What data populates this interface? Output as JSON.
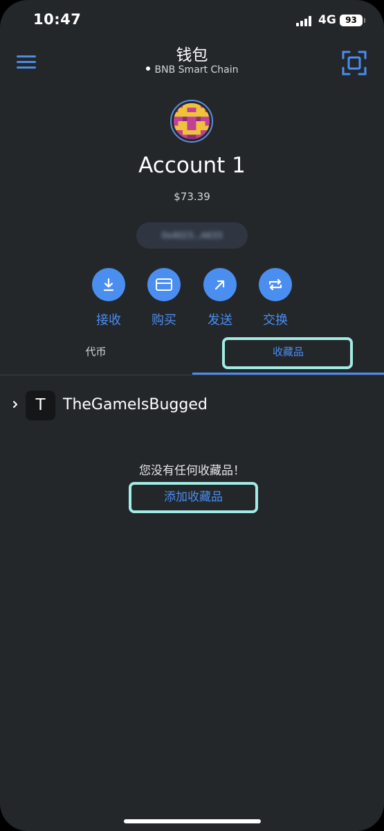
{
  "status_bar": {
    "time": "10:47",
    "network": "4G",
    "battery": "93"
  },
  "header": {
    "title": "钱包",
    "network_name": "BNB Smart Chain"
  },
  "account": {
    "name": "Account 1",
    "balance": "$73.39",
    "address": "0x4023...A633"
  },
  "actions": [
    {
      "label": "接收",
      "icon": "download-icon"
    },
    {
      "label": "购买",
      "icon": "card-icon"
    },
    {
      "label": "发送",
      "icon": "arrow-up-right-icon"
    },
    {
      "label": "交换",
      "icon": "swap-icon"
    }
  ],
  "tabs": [
    {
      "label": "代币",
      "active": false
    },
    {
      "label": "收藏品",
      "active": true
    }
  ],
  "collection": {
    "initial": "T",
    "name": "TheGameIsBugged"
  },
  "empty_state": {
    "message": "您没有任何收藏品！",
    "add_label": "添加收藏品"
  },
  "colors": {
    "background": "#24272a",
    "accent": "#4a8ef0",
    "highlight": "#a2ece6"
  }
}
